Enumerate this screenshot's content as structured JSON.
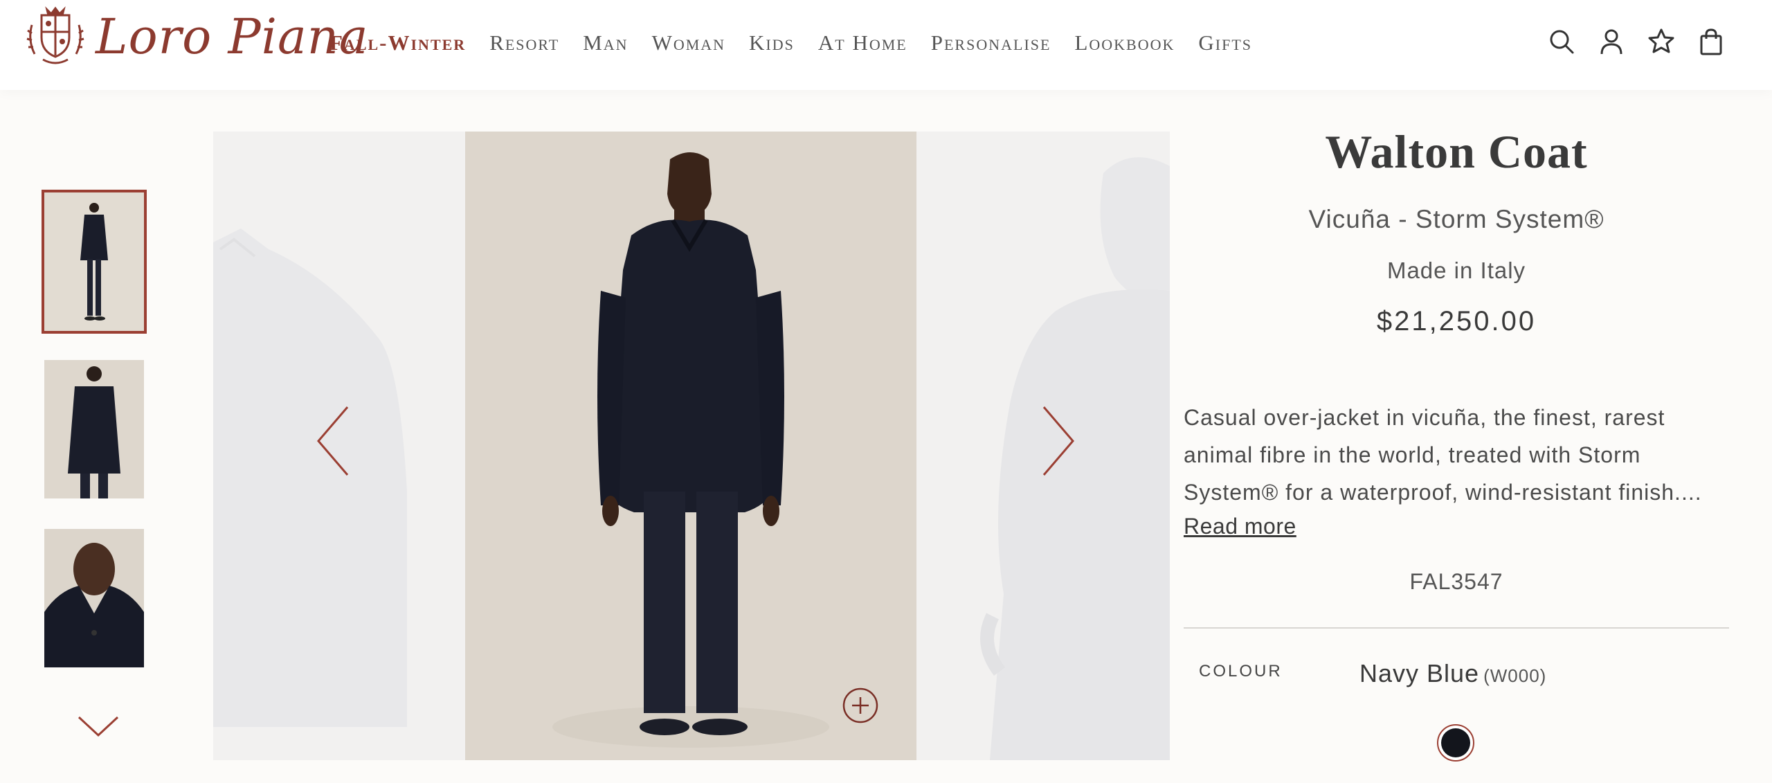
{
  "brand": {
    "wordmark": "Loro Piana",
    "accent_color": "#8c3a2f"
  },
  "nav": {
    "items": [
      {
        "label": "Fall-Winter",
        "active": true
      },
      {
        "label": "Resort",
        "active": false
      },
      {
        "label": "Man",
        "active": false
      },
      {
        "label": "Woman",
        "active": false
      },
      {
        "label": "Kids",
        "active": false
      },
      {
        "label": "At Home",
        "active": false
      },
      {
        "label": "Personalise",
        "active": false
      },
      {
        "label": "Lookbook",
        "active": false
      },
      {
        "label": "Gifts",
        "active": false
      }
    ]
  },
  "header_icons": [
    "search-icon",
    "account-icon",
    "wishlist-star-icon",
    "shopping-bag-icon"
  ],
  "gallery": {
    "thumbnails": [
      {
        "view": "front full-length",
        "selected": true
      },
      {
        "view": "back full-length",
        "selected": false
      },
      {
        "view": "collar close-up",
        "selected": false
      }
    ],
    "controls": [
      "chevron-down-icon",
      "chevron-left-icon",
      "chevron-right-icon",
      "zoom-plus-icon"
    ]
  },
  "product": {
    "title": "Walton Coat",
    "subtitle": "Vicuña - Storm System®",
    "origin": "Made in Italy",
    "price": "$21,250.00",
    "description": "Casual over-jacket in vicuña, the finest, rarest animal fibre in the world, treated with Storm System® for a waterproof, wind-resistant finish....",
    "read_more": "Read more",
    "code": "FAL3547",
    "colour_label": "COLOUR",
    "colour_name": "Navy Blue",
    "colour_code": "(W000)",
    "swatch_color": "#13151c"
  }
}
